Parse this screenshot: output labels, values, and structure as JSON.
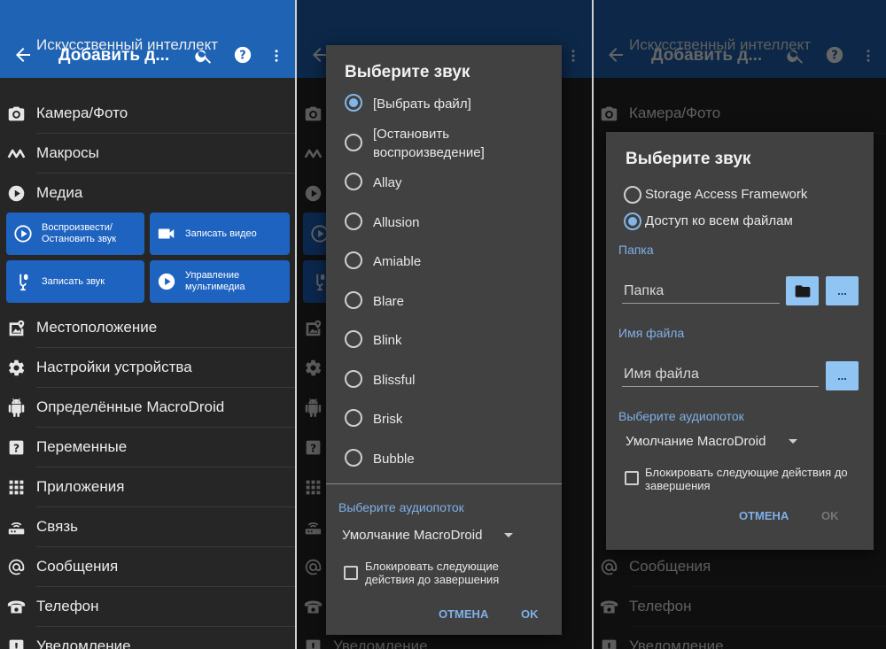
{
  "topbar": {
    "title": "Добавить д..."
  },
  "list": {
    "partial_top": "Искусственный интеллект",
    "items": [
      {
        "label": "Камера/Фото",
        "icon": "camera-icon"
      },
      {
        "label": "Макросы",
        "icon": "macrodroid-m-icon"
      },
      {
        "label": "Медиа",
        "icon": "play-circle-icon"
      },
      {
        "label": "Местоположение",
        "icon": "map-location-icon"
      },
      {
        "label": "Настройки устройства",
        "icon": "gear-icon"
      },
      {
        "label": "Определённые MacroDroid",
        "icon": "android-icon"
      },
      {
        "label": "Переменные",
        "icon": "question-box-icon"
      },
      {
        "label": "Приложения",
        "icon": "apps-grid-icon"
      },
      {
        "label": "Связь",
        "icon": "router-icon"
      },
      {
        "label": "Сообщения",
        "icon": "at-sign-icon"
      },
      {
        "label": "Телефон",
        "icon": "phone-icon"
      },
      {
        "label": "Уведомление",
        "icon": "notification-icon"
      }
    ],
    "media_tiles": [
      {
        "label": "Воспроизвести/\nОстановить звук",
        "icon": "play-circle-icon"
      },
      {
        "label": "Записать видео",
        "icon": "video-camera-icon"
      },
      {
        "label": "Записать звук",
        "icon": "microphone-icon"
      },
      {
        "label": "Управление\nмультимедиа",
        "icon": "play-circle-icon"
      }
    ]
  },
  "dialog_sound": {
    "title": "Выберите звук",
    "options": [
      {
        "label": "[Выбрать файл]",
        "selected": true
      },
      {
        "label": "[Остановить\nвоспроизведение]",
        "selected": false
      },
      {
        "label": "Allay",
        "selected": false
      },
      {
        "label": "Allusion",
        "selected": false
      },
      {
        "label": "Amiable",
        "selected": false
      },
      {
        "label": "Blare",
        "selected": false
      },
      {
        "label": "Blink",
        "selected": false
      },
      {
        "label": "Blissful",
        "selected": false
      },
      {
        "label": "Brisk",
        "selected": false
      },
      {
        "label": "Bubble",
        "selected": false
      }
    ],
    "stream_label": "Выберите аудиопоток",
    "stream_value": "Умолчание MacroDroid",
    "block_label": "Блокировать следующие\nдействия до завершения",
    "cancel": "ОТМЕНА",
    "ok": "OK"
  },
  "dialog_file": {
    "title": "Выберите звук",
    "modes": [
      {
        "label": "Storage Access Framework",
        "selected": false
      },
      {
        "label": "Доступ ко всем файлам",
        "selected": true
      }
    ],
    "folder_label": "Папка",
    "folder_placeholder": "Папка",
    "filename_label": "Имя файла",
    "filename_placeholder": "Имя файла",
    "browse_label": "...",
    "stream_label": "Выберите аудиопоток",
    "stream_value": "Умолчание MacroDroid",
    "block_label": "Блокировать следующие действия до\nзавершения",
    "cancel": "ОТМЕНА",
    "ok": "OK"
  },
  "colors": {
    "accent": "#1f63b5",
    "tile": "#1e63c0",
    "link": "#7fb0e8",
    "dialog": "#414141"
  }
}
